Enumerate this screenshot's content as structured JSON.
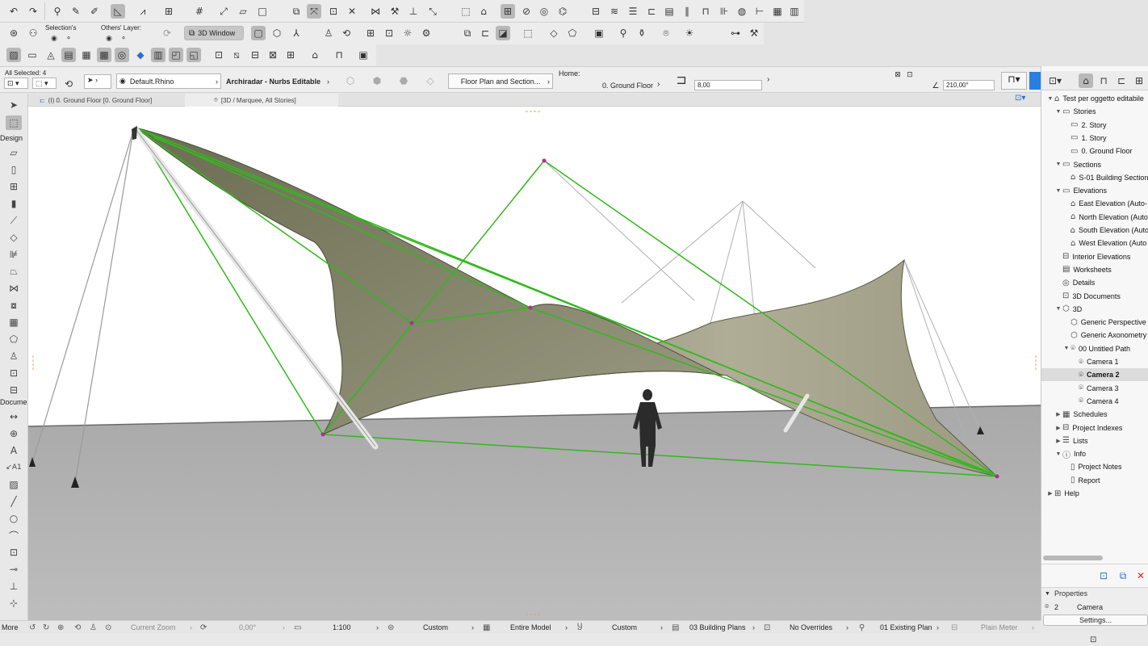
{
  "toolbar": {
    "all_selected": "All Selected: 4",
    "selection_label": "Selection's",
    "others_layer_label": "Others' Layer:",
    "window_3d_label": "3D Window",
    "layer_value": "Default.Rhino",
    "element_name": "Archiradar - Nurbs Editable",
    "floor_plan_section": "Floor Plan and Section...",
    "home_label": "Home:",
    "home_value": "0. Ground Floor",
    "height_value": "8,00",
    "angle_value": "210,00°"
  },
  "tabs": [
    {
      "label": "(I) 0. Ground Floor [0. Ground Floor]"
    },
    {
      "label": "[3D / Marquee, All Stories]"
    }
  ],
  "toolbox": {
    "design_label": "Design",
    "document_label": "Docume",
    "more_label": "More"
  },
  "navigator": {
    "items": [
      {
        "label": "Test per oggetto editabile",
        "tri": "▼",
        "icon": "house"
      },
      {
        "label": "Stories",
        "tri": "▼",
        "icon": "folder"
      },
      {
        "label": "2. Story",
        "tri": "",
        "icon": "story"
      },
      {
        "label": "1. Story",
        "tri": "",
        "icon": "story"
      },
      {
        "label": "0. Ground Floor",
        "tri": "",
        "icon": "story"
      },
      {
        "label": "Sections",
        "tri": "▼",
        "icon": "folder"
      },
      {
        "label": "S-01 Building Section",
        "tri": "",
        "icon": "section"
      },
      {
        "label": "Elevations",
        "tri": "▼",
        "icon": "folder"
      },
      {
        "label": "East Elevation (Auto-",
        "tri": "",
        "icon": "elevation"
      },
      {
        "label": "North Elevation (Auto",
        "tri": "",
        "icon": "elevation"
      },
      {
        "label": "South Elevation (Auto",
        "tri": "",
        "icon": "elevation"
      },
      {
        "label": "West Elevation (Auto",
        "tri": "",
        "icon": "elevation"
      },
      {
        "label": "Interior Elevations",
        "tri": "",
        "icon": "interior"
      },
      {
        "label": "Worksheets",
        "tri": "",
        "icon": "worksheet"
      },
      {
        "label": "Details",
        "tri": "",
        "icon": "detail"
      },
      {
        "label": "3D Documents",
        "tri": "",
        "icon": "doc3d"
      },
      {
        "label": "3D",
        "tri": "▼",
        "icon": "cube"
      },
      {
        "label": "Generic Perspective",
        "tri": "",
        "icon": "perspective"
      },
      {
        "label": "Generic Axonometry",
        "tri": "",
        "icon": "axonometry"
      },
      {
        "label": "00 Untitled Path",
        "tri": "▼",
        "icon": "path"
      },
      {
        "label": "Camera 1",
        "tri": "",
        "icon": "camera"
      },
      {
        "label": "Camera 2",
        "tri": "",
        "icon": "camera"
      },
      {
        "label": "Camera 3",
        "tri": "",
        "icon": "camera"
      },
      {
        "label": "Camera 4",
        "tri": "",
        "icon": "camera"
      },
      {
        "label": "Schedules",
        "tri": "▶",
        "icon": "schedule"
      },
      {
        "label": "Project Indexes",
        "tri": "▶",
        "icon": "index"
      },
      {
        "label": "Lists",
        "tri": "▶",
        "icon": "list"
      },
      {
        "label": "Info",
        "tri": "▼",
        "icon": "info"
      },
      {
        "label": "Project Notes",
        "tri": "",
        "icon": "note"
      },
      {
        "label": "Report",
        "tri": "",
        "icon": "report"
      },
      {
        "label": "Help",
        "tri": "▶",
        "icon": "help"
      }
    ],
    "selected_item": "Camera 2"
  },
  "properties": {
    "header": "Properties",
    "id_value": "2",
    "type_value": "Camera",
    "settings_button": "Settings..."
  },
  "statusbar": {
    "more": "More",
    "current_zoom": "Current Zoom",
    "angle": "0,00°",
    "scale": "1:100",
    "layer_combo": "Custom",
    "model_view": "Entire Model",
    "pen_set": "Custom",
    "mvo": "03 Building Plans",
    "overrides": "No Overrides",
    "renovation": "01 Existing Plan",
    "dimension": "Plain Meter"
  },
  "colors": {
    "selection_green": "#33b81e",
    "membrane": "#8f8f74",
    "ground": "#b4b4b4",
    "background": "#ffffff"
  }
}
